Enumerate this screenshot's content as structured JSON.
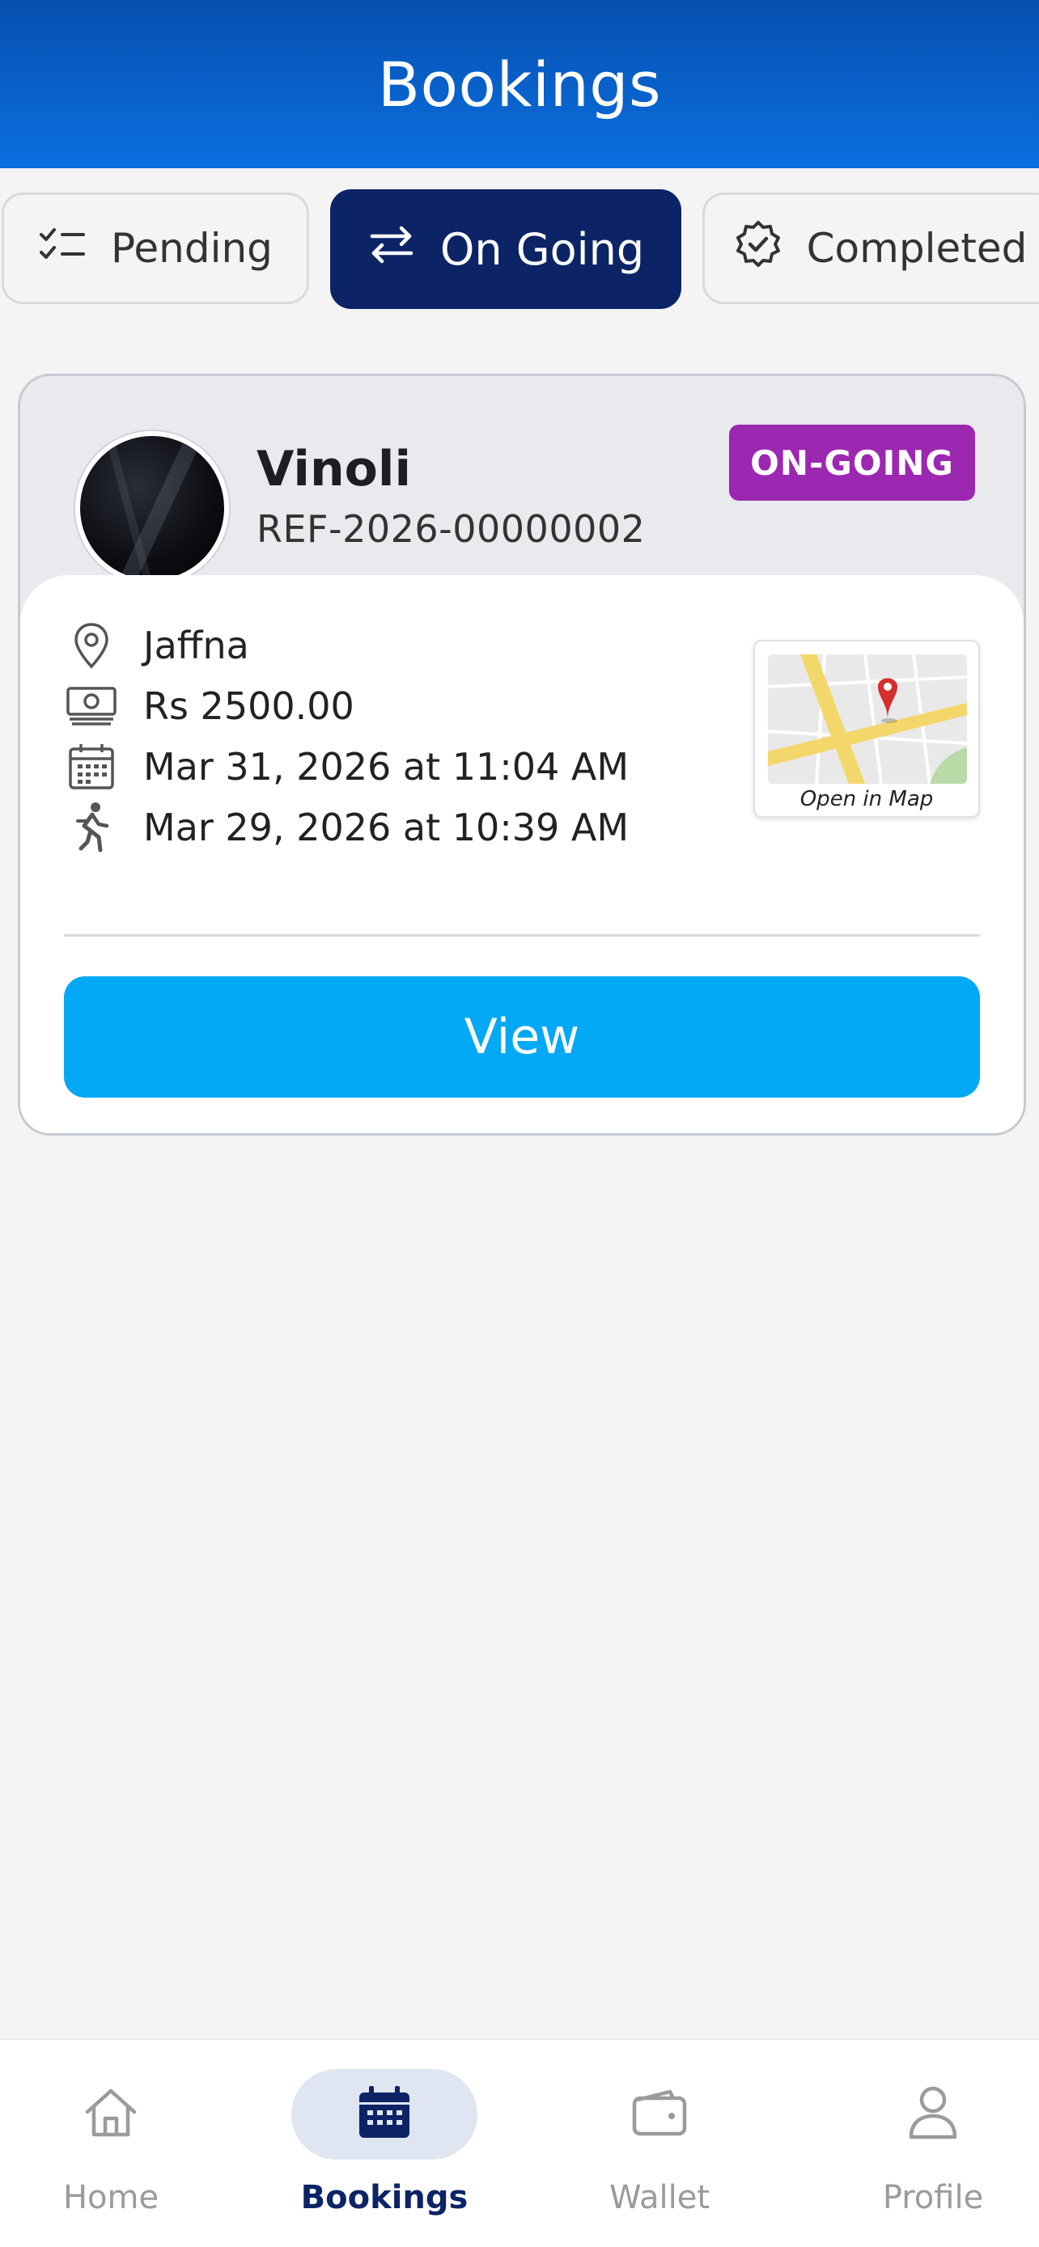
{
  "header": {
    "title": "Bookings"
  },
  "tabs": [
    {
      "label": "Pending",
      "icon": "checklist-icon",
      "active": false
    },
    {
      "label": "On Going",
      "icon": "swap-arrows-icon",
      "active": true
    },
    {
      "label": "Completed",
      "icon": "verified-badge-icon",
      "active": false
    }
  ],
  "booking": {
    "name": "Vinoli",
    "reference": "REF-2026-00000002",
    "status": "ON-GOING",
    "location": "Jaffna",
    "amount": "Rs 2500.00",
    "scheduled": "Mar 31, 2026 at 11:04 AM",
    "started": "Mar 29, 2026 at 10:39 AM",
    "map_label": "Open in Map",
    "view_label": "View"
  },
  "nav": [
    {
      "label": "Home",
      "icon": "home-icon"
    },
    {
      "label": "Bookings",
      "icon": "calendar-icon",
      "active": true
    },
    {
      "label": "Wallet",
      "icon": "wallet-icon"
    },
    {
      "label": "Profile",
      "icon": "person-icon"
    }
  ],
  "colors": {
    "header": "#0a6fe0",
    "active_tab": "#0c2466",
    "status_badge": "#9c27b0",
    "view_button": "#03a9f4"
  }
}
